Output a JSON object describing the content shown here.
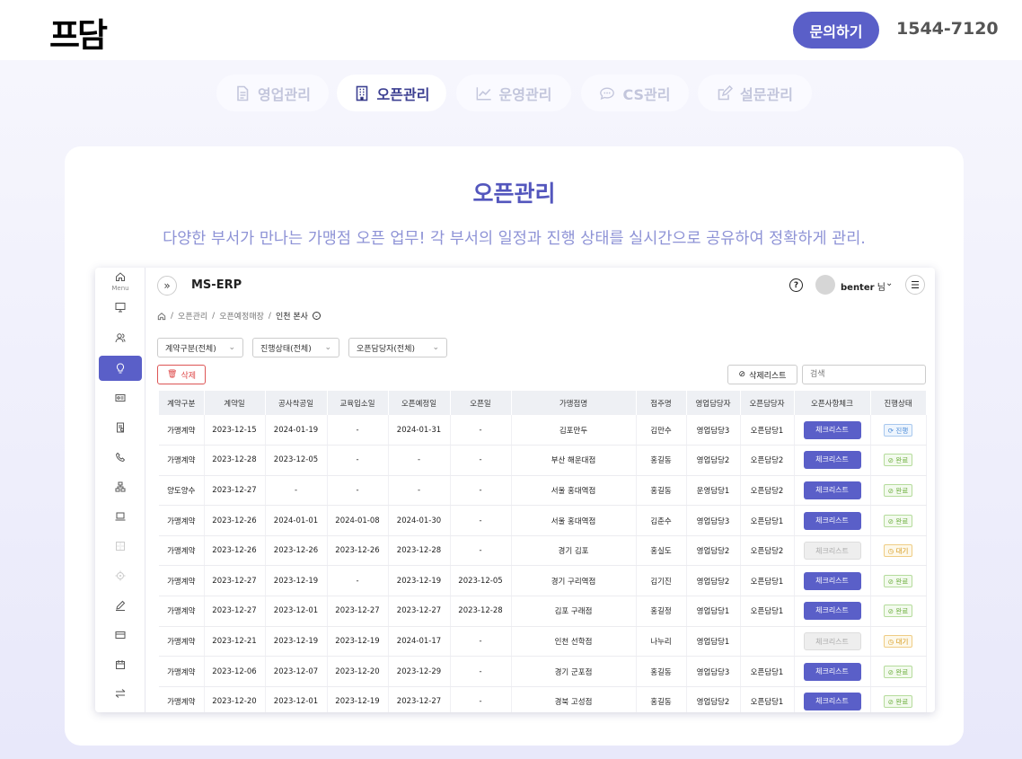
{
  "header": {
    "logo": "프담",
    "inquiry_button": "문의하기",
    "phone": "1544-7120"
  },
  "tabs": [
    {
      "label": "영업관리",
      "icon": "document-icon",
      "active": false
    },
    {
      "label": "오픈관리",
      "icon": "building-icon",
      "active": true
    },
    {
      "label": "운영관리",
      "icon": "chart-line-icon",
      "active": false
    },
    {
      "label": "CS관리",
      "icon": "chat-icon",
      "active": false
    },
    {
      "label": "설문관리",
      "icon": "edit-icon",
      "active": false
    }
  ],
  "section": {
    "title": "오픈관리",
    "subtitle": "다양한 부서가 만나는 가맹점 오픈 업무! 각 부서의 일정과 진행 상태를 실시간으로 공유하여 정확하게 관리."
  },
  "app": {
    "menu_label": "Menu",
    "title": "MS-ERP",
    "user_name": "benter",
    "user_suffix": " 님",
    "breadcrumb": [
      "오픈관리",
      "오픈예정매장",
      "인천 본사"
    ],
    "filters": [
      "계약구분(전체)",
      "진행상태(전체)",
      "오픈담당자(전체)"
    ],
    "delete_button": "삭제",
    "deleted_list_button": "삭제리스트",
    "search_placeholder": "검색",
    "columns": [
      "계약구분",
      "계약일",
      "공사착공일",
      "교육입소일",
      "오픈예정일",
      "오픈일",
      "가맹점명",
      "점주명",
      "영업담당자",
      "오픈담당자",
      "오픈사항체크",
      "진행상태"
    ],
    "check_label": "체크리스트",
    "rows": [
      {
        "type": "가맹계약",
        "contract": "2023-12-15",
        "construct": "2024-01-19",
        "edu": "-",
        "plan": "2024-01-31",
        "open": "-",
        "store": "김포만두",
        "owner": "김만수",
        "sales": "영업담당3",
        "opener": "오픈담당1",
        "check_disabled": false,
        "status": "진행",
        "status_kind": "prog"
      },
      {
        "type": "가맹계약",
        "contract": "2023-12-28",
        "construct": "2023-12-05",
        "edu": "-",
        "plan": "-",
        "open": "-",
        "store": "부산 해운대점",
        "owner": "홍길동",
        "sales": "영업담당2",
        "opener": "오픈담당2",
        "check_disabled": false,
        "status": "완료",
        "status_kind": "done"
      },
      {
        "type": "양도양수",
        "contract": "2023-12-27",
        "construct": "-",
        "edu": "-",
        "plan": "-",
        "open": "-",
        "store": "서울 홍대역점",
        "owner": "홍길동",
        "sales": "운영담당1",
        "opener": "오픈담당2",
        "check_disabled": false,
        "status": "완료",
        "status_kind": "done"
      },
      {
        "type": "가맹계약",
        "contract": "2023-12-26",
        "construct": "2024-01-01",
        "edu": "2024-01-08",
        "plan": "2024-01-30",
        "open": "-",
        "store": "서울 홍대역점",
        "owner": "김춘수",
        "sales": "영업담당3",
        "opener": "오픈담당1",
        "check_disabled": false,
        "status": "완료",
        "status_kind": "done"
      },
      {
        "type": "가맹계약",
        "contract": "2023-12-26",
        "construct": "2023-12-26",
        "edu": "2023-12-26",
        "plan": "2023-12-28",
        "open": "-",
        "store": "경기 김포",
        "owner": "홍실도",
        "sales": "영업담당2",
        "opener": "오픈담당2",
        "check_disabled": true,
        "status": "대기",
        "status_kind": "wait"
      },
      {
        "type": "가맹계약",
        "contract": "2023-12-27",
        "construct": "2023-12-19",
        "edu": "-",
        "plan": "2023-12-19",
        "open": "2023-12-05",
        "store": "경기 구리역점",
        "owner": "김기진",
        "sales": "영업담당2",
        "opener": "오픈담당1",
        "check_disabled": false,
        "status": "완료",
        "status_kind": "done"
      },
      {
        "type": "가맹계약",
        "contract": "2023-12-27",
        "construct": "2023-12-01",
        "edu": "2023-12-27",
        "plan": "2023-12-27",
        "open": "2023-12-28",
        "store": "김포 구래점",
        "owner": "홍길정",
        "sales": "영업담당1",
        "opener": "오픈담당1",
        "check_disabled": false,
        "status": "완료",
        "status_kind": "done"
      },
      {
        "type": "가맹계약",
        "contract": "2023-12-21",
        "construct": "2023-12-19",
        "edu": "2023-12-19",
        "plan": "2024-01-17",
        "open": "-",
        "store": "인천 선학점",
        "owner": "나누리",
        "sales": "영업담당1",
        "opener": "",
        "check_disabled": true,
        "status": "대기",
        "status_kind": "wait"
      },
      {
        "type": "가맹계약",
        "contract": "2023-12-06",
        "construct": "2023-12-07",
        "edu": "2023-12-20",
        "plan": "2023-12-29",
        "open": "-",
        "store": "경기 군포점",
        "owner": "홍길동",
        "sales": "영업담당3",
        "opener": "오픈담당1",
        "check_disabled": false,
        "status": "완료",
        "status_kind": "done"
      },
      {
        "type": "가맹계약",
        "contract": "2023-12-20",
        "construct": "2023-12-01",
        "edu": "2023-12-19",
        "plan": "2023-12-27",
        "open": "-",
        "store": "경북 고성점",
        "owner": "홍길동",
        "sales": "영업담당2",
        "opener": "오픈담당1",
        "check_disabled": false,
        "status": "완료",
        "status_kind": "done"
      }
    ]
  },
  "colors": {
    "accent": "#5a5fc8",
    "title": "#5356bd",
    "subtitle": "#8e93d6"
  }
}
